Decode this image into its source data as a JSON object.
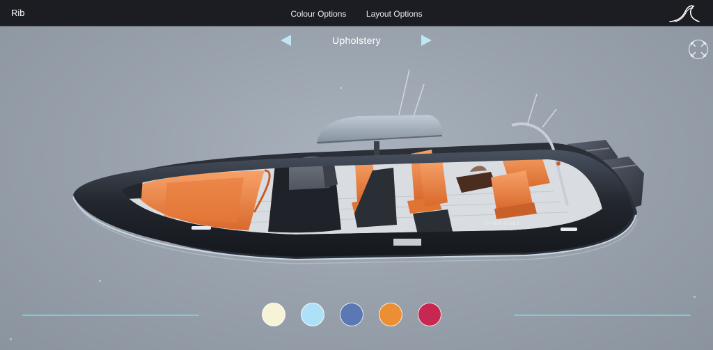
{
  "app": {
    "title": "Rib"
  },
  "nav": {
    "colour_options": "Colour Options",
    "layout_options": "Layout Options"
  },
  "configurator": {
    "category_label": "Upholstery",
    "prev_icon": "triangle-left-icon",
    "next_icon": "triangle-right-icon",
    "fullscreen_icon": "expand-arrows-icon"
  },
  "boat": {
    "hull_text": "OTHER SKIES"
  },
  "swatches": [
    {
      "name": "cream",
      "color": "#f7f3d6"
    },
    {
      "name": "light-blue",
      "color": "#aee1f7"
    },
    {
      "name": "slate-blue",
      "color": "#5a78b4"
    },
    {
      "name": "orange",
      "color": "#ec8e34"
    },
    {
      "name": "crimson",
      "color": "#c72852"
    }
  ],
  "colors": {
    "topbar": "#1c1d22",
    "accent_line": "#7fd0d8",
    "upholstery": "#f08a45"
  }
}
